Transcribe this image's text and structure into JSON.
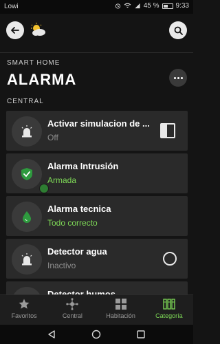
{
  "status_bar": {
    "carrier": "Lowi",
    "battery": "45 %",
    "time": "9:33"
  },
  "header": {
    "back_icon": "arrow-left-icon",
    "weather_icon": "partly-cloudy-icon",
    "search_icon": "search-icon"
  },
  "section_label": "SMART HOME",
  "page_title": "ALARMA",
  "group_label": "CENTRAL",
  "devices": [
    {
      "name": "Activar simulacion de ...",
      "status": "Off",
      "icon": "siren-icon",
      "control": "toggle",
      "status_color": "#8e8e8e"
    },
    {
      "name": "Alarma Intrusión",
      "status": "Armada",
      "icon": "shield-check-icon",
      "control": "none",
      "status_color": "#7ed957"
    },
    {
      "name": "Alarma tecnica",
      "status": "Todo correcto",
      "icon": "water-drop-icon",
      "control": "none",
      "status_color": "#7ed957"
    },
    {
      "name": "Detector agua",
      "status": "Inactivo",
      "icon": "siren-icon",
      "control": "radio",
      "status_color": "#8e8e8e"
    },
    {
      "name": "Detector humos",
      "status": "",
      "icon": "siren-icon",
      "control": "none",
      "status_color": "#8e8e8e"
    }
  ],
  "bottom_nav": [
    {
      "label": "Favoritos",
      "icon": "star-icon",
      "active": false
    },
    {
      "label": "Central",
      "icon": "hub-icon",
      "active": false
    },
    {
      "label": "Habitación",
      "icon": "grid-icon",
      "active": false
    },
    {
      "label": "Categoría",
      "icon": "columns-icon",
      "active": true
    }
  ],
  "colors": {
    "accent": "#7ed957",
    "background": "#141414",
    "card": "#2a2a2a"
  }
}
